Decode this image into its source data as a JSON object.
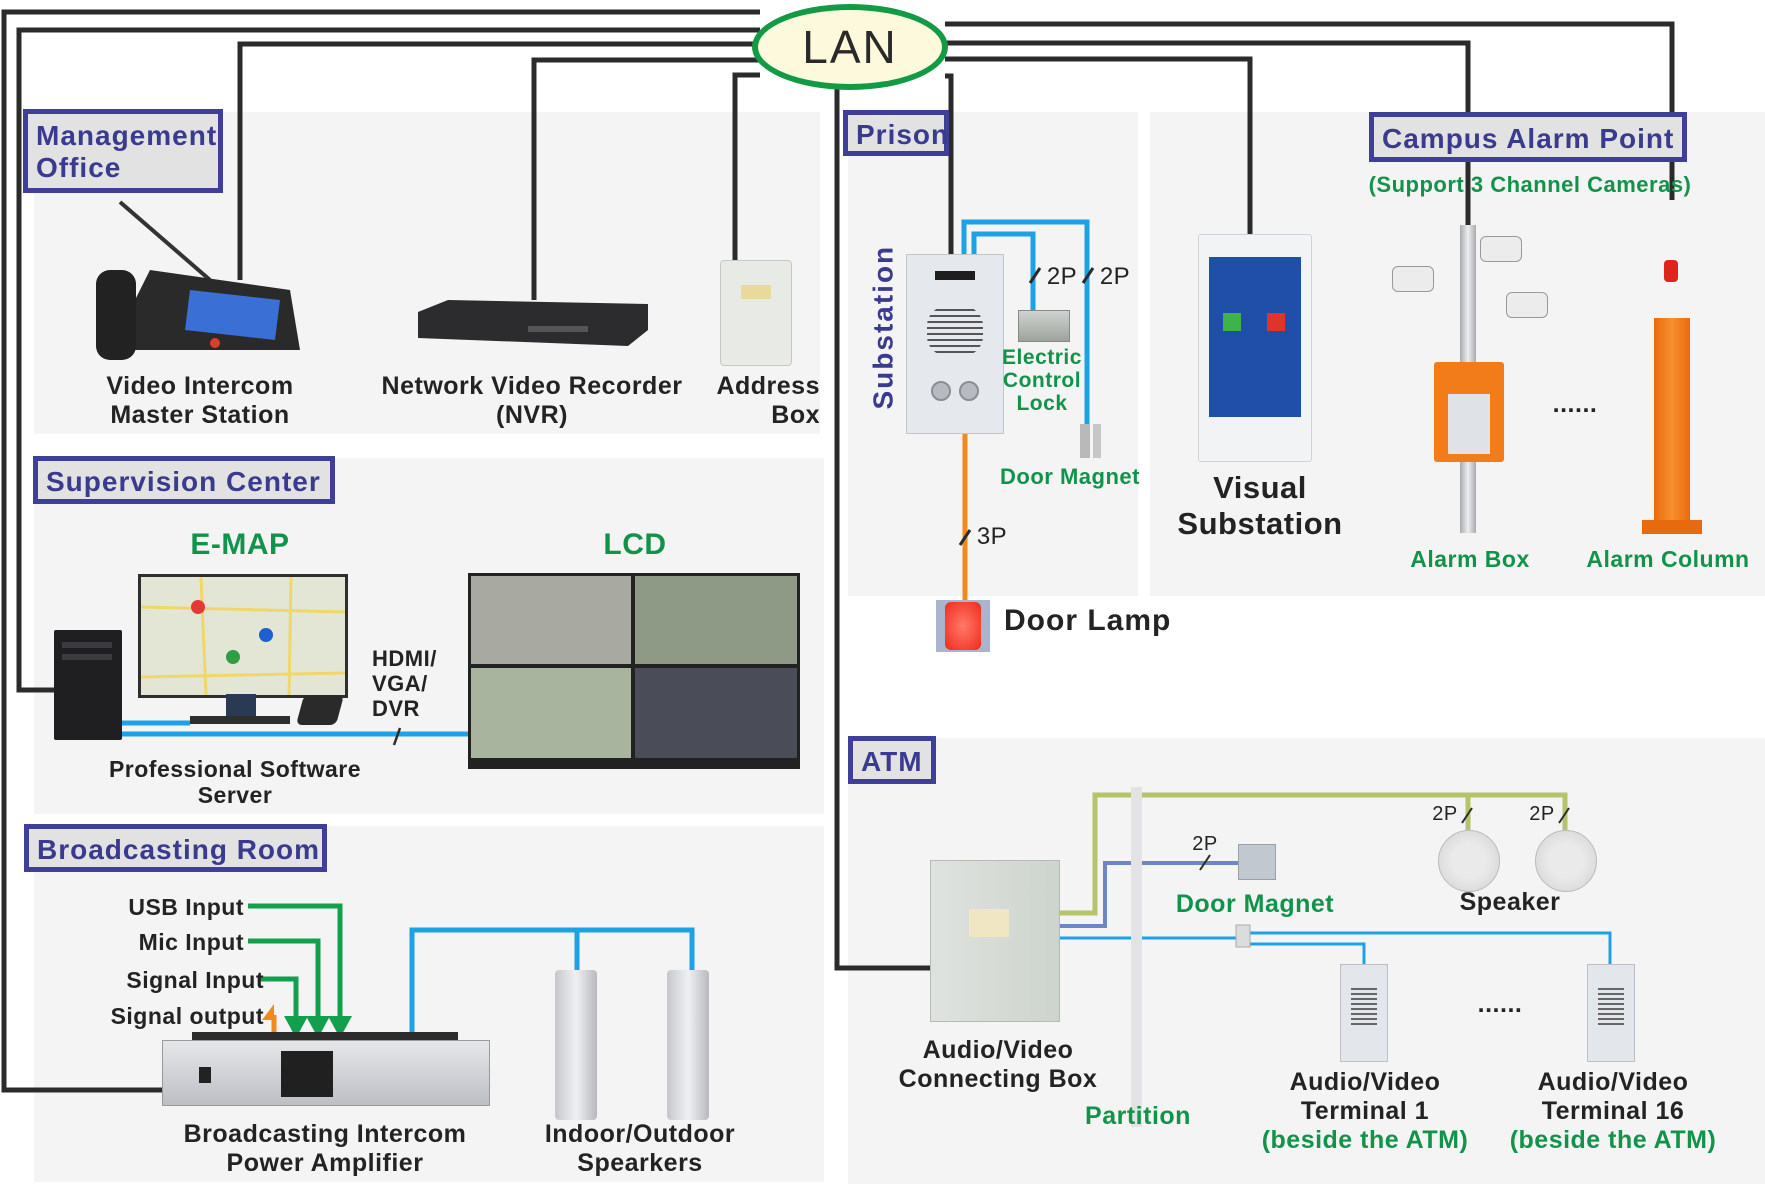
{
  "network": {
    "hub_label": "LAN"
  },
  "colors": {
    "section_border": "#3f3f9a",
    "section_text": "#3a3a8f",
    "green_label": "#12934a",
    "lan_wire": "#2b2b2b",
    "signal_wire_blue": "#1ea2e6",
    "power_wire_orange": "#f08a1c",
    "speaker_wire_olive": "#b5c46a",
    "door_wire_slate": "#6f86c6",
    "lan_ellipse_border": "#139a45",
    "lan_ellipse_fill": "#fdf9dc"
  },
  "sections": {
    "management_office": {
      "title": "Management Office",
      "title_line1": "Management",
      "title_line2": "Office",
      "devices": [
        {
          "line1": "Video Intercom",
          "line2": "Master Station"
        },
        {
          "line1": "Network Video Recorder",
          "line2": "(NVR)"
        },
        {
          "line1": "Address",
          "line2": "Box"
        }
      ]
    },
    "supervision_center": {
      "title": "Supervision Center",
      "emap_label": "E-MAP",
      "lcd_label": "LCD",
      "connection_line1": "HDMI/",
      "connection_line2": "VGA/",
      "connection_line3": "DVR",
      "server_line1": "Professional Software",
      "server_line2": "Server"
    },
    "broadcasting_room": {
      "title": "Broadcasting Room",
      "inputs": [
        "USB Input",
        "Mic Input",
        "Signal Input",
        "Signal output"
      ],
      "amplifier_line1": "Broadcasting Intercom",
      "amplifier_line2": "Power Amplifier",
      "speakers_line1": "Indoor/Outdoor",
      "speakers_line2": "Spearkers"
    },
    "prison": {
      "title": "Prison",
      "substation_label": "Substation",
      "wire_lock": "2P",
      "wire_magnet": "2P",
      "wire_lamp": "3P",
      "lock_line1": "Electric",
      "lock_line2": "Control",
      "lock_line3": "Lock",
      "door_magnet": "Door Magnet",
      "door_lamp": "Door Lamp",
      "visual_line1": "Visual",
      "visual_line2": "Substation"
    },
    "campus_alarm": {
      "title": "Campus Alarm Point",
      "subtitle": "(Support 3 Channel Cameras)",
      "alarm_box": "Alarm Box",
      "alarm_column": "Alarm Column",
      "ellipsis": "......"
    },
    "atm": {
      "title": "ATM",
      "box_line1": "Audio/Video",
      "box_line2": "Connecting Box",
      "partition": "Partition",
      "door_magnet": "Door Magnet",
      "door_wire": "2P",
      "speaker": "Speaker",
      "speaker_wire1": "2P",
      "speaker_wire2": "2P",
      "terminal1_line1": "Audio/Video",
      "terminal1_line2": "Terminal 1",
      "terminal1_line3": "(beside the ATM)",
      "terminal16_line1": "Audio/Video",
      "terminal16_line2": "Terminal 16",
      "terminal16_line3": "(beside the ATM)",
      "ellipsis": "......"
    }
  }
}
